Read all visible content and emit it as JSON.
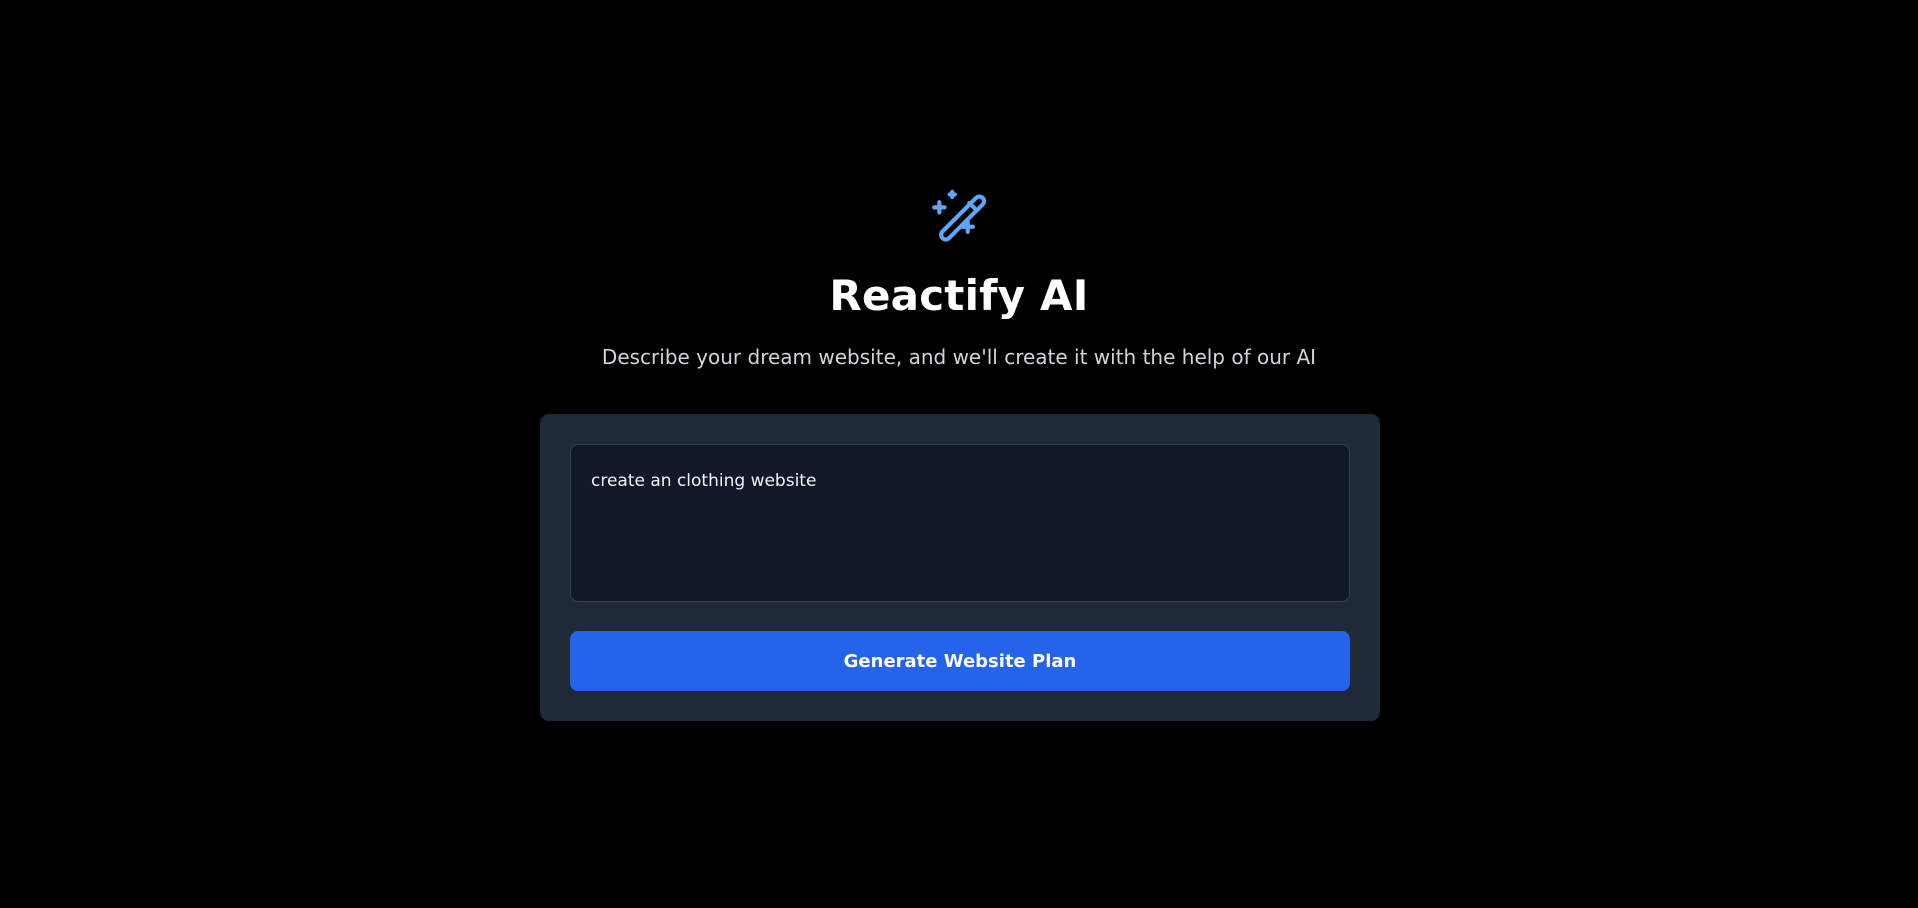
{
  "header": {
    "icon": "magic-wand-sparkles-icon",
    "title": "Reactify AI",
    "subtitle": "Describe your dream website, and we'll create it with the help of our AI"
  },
  "form": {
    "prompt_value": "create an clothing website",
    "generate_label": "Generate Website Plan"
  },
  "colors": {
    "background": "#000000",
    "card": "#1f2937",
    "input_bg": "#111827",
    "accent": "#2563eb",
    "icon": "#60a5fa"
  }
}
